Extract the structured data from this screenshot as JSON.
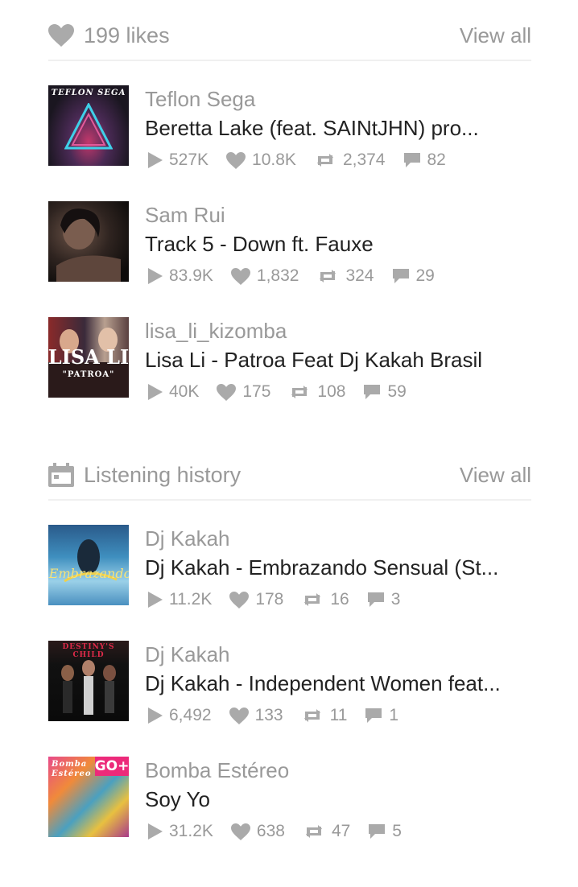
{
  "likes": {
    "title": "199 likes",
    "view_all": "View all",
    "tracks": [
      {
        "artist": "Teflon Sega",
        "title": "Beretta Lake (feat. SAINtJHN) pro...",
        "plays": "527K",
        "likes": "10.8K",
        "reposts": "2,374",
        "comments": "82",
        "art_text": "TEFLON SEGA"
      },
      {
        "artist": "Sam Rui",
        "title": "Track 5 - Down ft. Fauxe",
        "plays": "83.9K",
        "likes": "1,832",
        "reposts": "324",
        "comments": "29",
        "art_text": ""
      },
      {
        "artist": "lisa_li_kizomba",
        "title": "Lisa Li - Patroa Feat Dj Kakah Brasil",
        "plays": "40K",
        "likes": "175",
        "reposts": "108",
        "comments": "59",
        "art_text": "\"PATROA\""
      }
    ]
  },
  "history": {
    "title": "Listening history",
    "view_all": "View all",
    "tracks": [
      {
        "artist": "Dj Kakah",
        "title": "Dj Kakah - Embrazando Sensual (St...",
        "plays": "11.2K",
        "likes": "178",
        "reposts": "16",
        "comments": "3",
        "art_text": ""
      },
      {
        "artist": "Dj Kakah",
        "title": "Dj Kakah - Independent Women feat...",
        "plays": "6,492",
        "likes": "133",
        "reposts": "11",
        "comments": "1",
        "art_text": "DESTINY'S CHILD"
      },
      {
        "artist": "Bomba Estéreo",
        "title": "Soy Yo",
        "plays": "31.2K",
        "likes": "638",
        "reposts": "47",
        "comments": "5",
        "art_text": "Bomba Estéreo",
        "badge": "GO+"
      }
    ]
  },
  "icons": {
    "heart": "heart-icon",
    "calendar": "calendar-icon",
    "play": "play-icon",
    "repost": "repost-icon",
    "comment": "comment-icon"
  },
  "colors": {
    "muted": "#999999",
    "title": "#222222",
    "divider": "#f0f0f0",
    "badge": "#ec2a7a"
  }
}
